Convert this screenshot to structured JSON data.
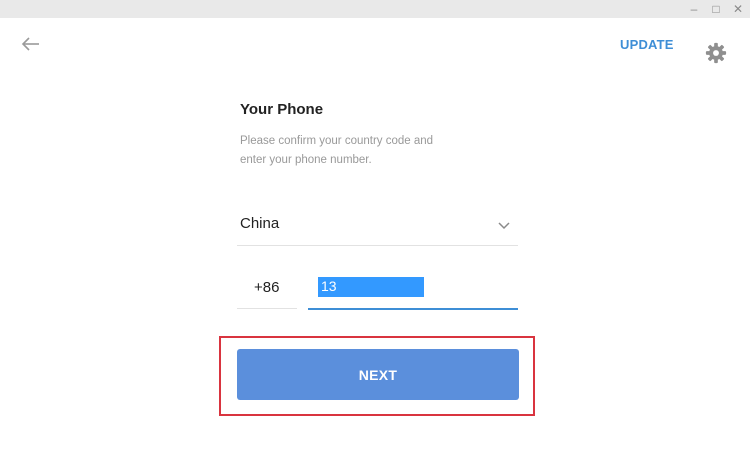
{
  "window": {
    "controls": {
      "minimize": "–",
      "maximize": "□",
      "close": "✕"
    }
  },
  "header": {
    "back_icon": "back-arrow-icon",
    "update_label": "UPDATE",
    "settings_icon": "gear-icon"
  },
  "form": {
    "title": "Your Phone",
    "description_line1": "Please confirm your country code and",
    "description_line2": "enter your phone number.",
    "country": {
      "value": "China",
      "icon": "chevron-down-icon"
    },
    "country_code": "+86",
    "phone_number": "13"
  },
  "actions": {
    "next_label": "NEXT"
  },
  "colors": {
    "accent": "#3e8ed6",
    "button": "#5b8fdc",
    "selection": "#3399ff",
    "highlight_box": "#d9343f",
    "titlebar": "#e9e9e9"
  }
}
